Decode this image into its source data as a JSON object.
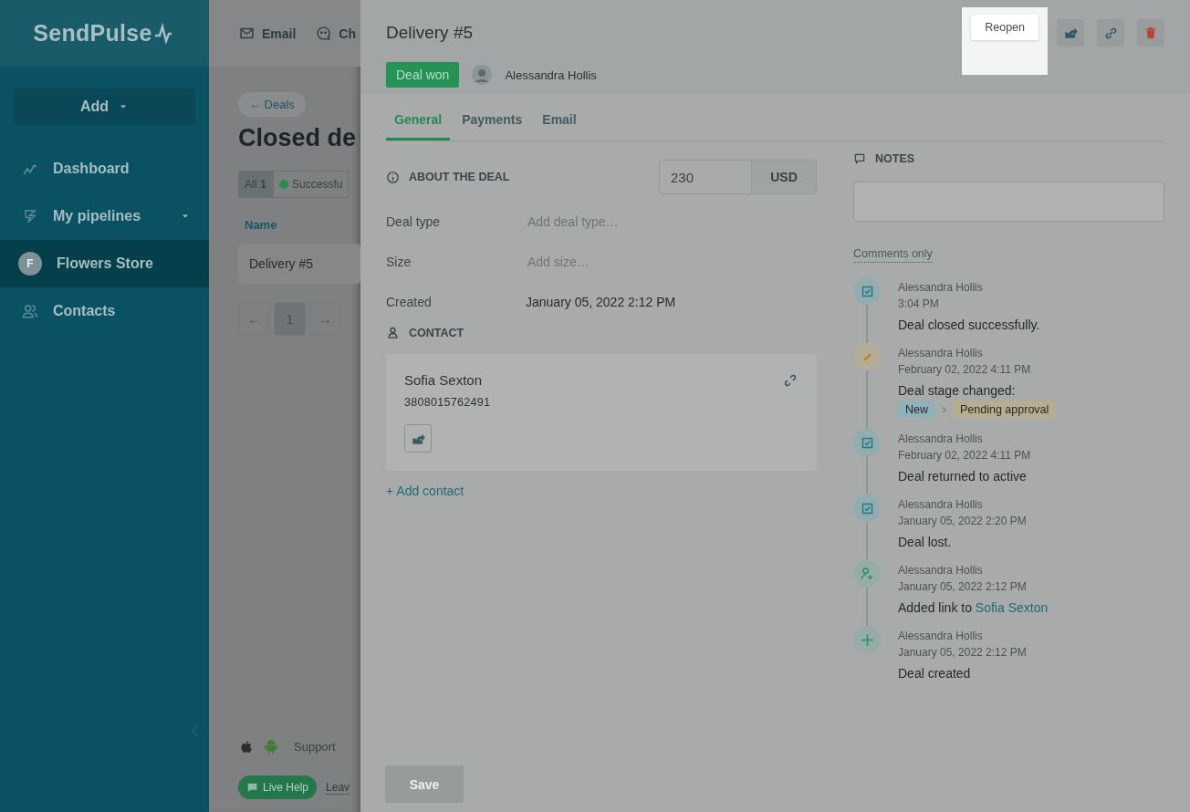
{
  "sidebar": {
    "logo": "SendPulse",
    "add_button": "Add",
    "items": [
      {
        "label": "Dashboard",
        "kind": "dashboard",
        "selected": false
      },
      {
        "label": "My pipelines",
        "kind": "pipelines",
        "selected": false
      },
      {
        "label": "Flowers Store",
        "kind": "workspace",
        "avatar": "F",
        "selected": true
      },
      {
        "label": "Contacts",
        "kind": "contacts",
        "selected": false
      }
    ]
  },
  "topbar": {
    "items": [
      {
        "label": "Email",
        "kind": "email"
      },
      {
        "label": "Ch",
        "kind": "chat"
      }
    ]
  },
  "page": {
    "back_link": "← Deals",
    "title": "Closed de",
    "filters": [
      {
        "label": "All",
        "count": "1",
        "selected": true
      },
      {
        "label": "Successfu",
        "color": "#2a8a52",
        "selected": false
      }
    ],
    "table": {
      "columns": [
        "Name"
      ],
      "rows": [
        [
          "Delivery #5"
        ]
      ]
    },
    "pagination": {
      "prev": "←",
      "pages": [
        {
          "label": "1",
          "selected": true
        }
      ],
      "next": "→"
    },
    "footer": {
      "support": "Support",
      "live_help": "Live Help",
      "leave": "Leav"
    }
  },
  "drawer": {
    "title": "Delivery #5",
    "reopen": "Reopen",
    "status": "Deal won",
    "owner": "Alessandra Hollis",
    "tabs": [
      {
        "label": "General",
        "selected": true
      },
      {
        "label": "Payments",
        "selected": false
      },
      {
        "label": "Email",
        "selected": false
      }
    ],
    "about": {
      "heading": "ABOUT THE DEAL",
      "amount": "230",
      "currency": "USD",
      "fields": [
        {
          "label": "Deal type",
          "placeholder": "Add deal type…"
        },
        {
          "label": "Size",
          "placeholder": "Add size…"
        },
        {
          "label": "Created",
          "value": "January 05, 2022 2:12 PM"
        }
      ]
    },
    "contact": {
      "heading": "CONTACT",
      "name": "Sofia Sexton",
      "phone": "3808015762491",
      "add_link": "+ Add contact"
    },
    "save": {
      "label": "Save",
      "disabled": true
    },
    "notes": {
      "heading": "NOTES",
      "filter": "Comments only",
      "events": [
        {
          "kind": "check",
          "author": "Alessandra Hollis",
          "time": "3:04 PM",
          "text": "Deal closed successfully."
        },
        {
          "kind": "edit",
          "author": "Alessandra Hollis",
          "time": "February 02, 2022 4:11 PM",
          "text": "Deal stage changed:",
          "stages": [
            {
              "label": "New",
              "color": "#8fb2ba"
            },
            {
              "label": "Pending approval",
              "color": "#b9ad8f"
            }
          ]
        },
        {
          "kind": "check",
          "author": "Alessandra Hollis",
          "time": "February 02, 2022 4:11 PM",
          "text": "Deal returned to active"
        },
        {
          "kind": "check",
          "author": "Alessandra Hollis",
          "time": "January 05, 2022 2:20 PM",
          "text": "Deal lost."
        },
        {
          "kind": "contact",
          "author": "Alessandra Hollis",
          "time": "January 05, 2022 2:12 PM",
          "text": "Added link to",
          "link": "Sofia Sexton"
        },
        {
          "kind": "create",
          "author": "Alessandra Hollis",
          "time": "January 05, 2022 2:12 PM",
          "text": "Deal created"
        }
      ]
    }
  }
}
